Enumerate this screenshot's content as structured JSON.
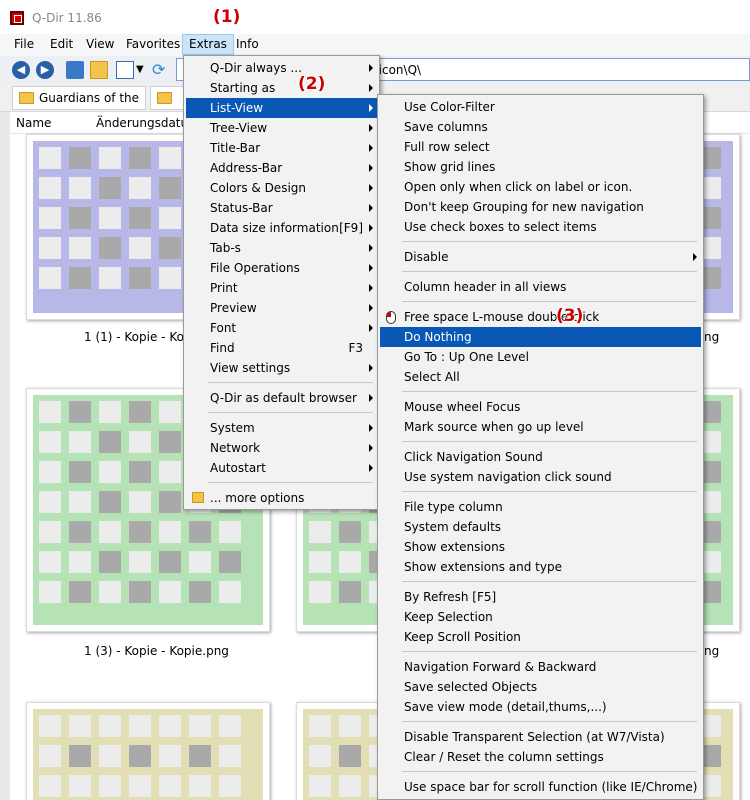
{
  "window": {
    "title": "Q-Dir 11.86"
  },
  "menubar": {
    "items": [
      "File",
      "Edit",
      "View",
      "Favorites",
      "Extras",
      "Info"
    ],
    "active": "Extras"
  },
  "address": {
    "value": "g\\icon\\Q\\"
  },
  "tabs": [
    {
      "label": "Guardians of the ..."
    }
  ],
  "columns": {
    "name": "Name",
    "date": "Änderungsdatum"
  },
  "thumbnails": [
    {
      "label": "1 (1) - Kopie - Kopi",
      "color": "#b7b7e8"
    },
    {
      "label": "1 (3) - Kopie - Kopie.png",
      "color": "#b5e3b5"
    }
  ],
  "thumb_right_labels": [
    "ng",
    "ng"
  ],
  "thumb_colors": {
    "purple": "#b7b7e8",
    "green": "#b5e3b5",
    "beige": "#e3dfb5",
    "cell": "#ececec",
    "dark": "#a9a9a9"
  },
  "extras_menu": {
    "items": [
      {
        "label": "Q-Dir always ...",
        "arrow": true
      },
      {
        "label": "Starting as",
        "arrow": true
      },
      {
        "label": "List-View",
        "arrow": true,
        "highlight": true
      },
      {
        "label": "Tree-View",
        "arrow": true
      },
      {
        "label": "Title-Bar",
        "arrow": true
      },
      {
        "label": "Address-Bar",
        "arrow": true
      },
      {
        "label": "Colors & Design",
        "arrow": true
      },
      {
        "label": "Status-Bar",
        "arrow": true
      },
      {
        "label": "Data size information",
        "shortcut": "[F9]",
        "arrow": true
      },
      {
        "label": "Tab-s",
        "arrow": true
      },
      {
        "label": "File Operations",
        "arrow": true
      },
      {
        "label": "Print",
        "arrow": true
      },
      {
        "label": "Preview",
        "arrow": true
      },
      {
        "label": "Font",
        "arrow": true
      },
      {
        "label": "Find",
        "shortcut": "F3"
      },
      {
        "label": "View settings",
        "arrow": true
      },
      {
        "label": "Q-Dir as default browser",
        "arrow": true
      },
      {
        "label": "System",
        "arrow": true
      },
      {
        "label": "Network",
        "arrow": true
      },
      {
        "label": "Autostart",
        "arrow": true
      },
      {
        "label": "... more options",
        "icon": "folder-icon"
      }
    ]
  },
  "listview_menu": {
    "items": [
      {
        "label": "Use Color-Filter"
      },
      {
        "label": "Save columns"
      },
      {
        "label": "Full row select"
      },
      {
        "label": "Show grid lines"
      },
      {
        "label": "Open only when click on label or icon."
      },
      {
        "label": "Don't keep Grouping for new navigation"
      },
      {
        "label": "Use check boxes to select items"
      },
      {
        "label": "Disable",
        "arrow": true
      },
      {
        "label": "Column header in all views"
      },
      {
        "label": "Free space L-mouse double-click",
        "icon": "mouse-icon"
      },
      {
        "label": "Do Nothing",
        "highlight": true
      },
      {
        "label": "Go To : Up One Level"
      },
      {
        "label": "Select All"
      },
      {
        "label": "Mouse wheel Focus"
      },
      {
        "label": "Mark source when go up level"
      },
      {
        "label": "Click Navigation Sound"
      },
      {
        "label": "Use system navigation click sound"
      },
      {
        "label": "File type column"
      },
      {
        "label": "System defaults"
      },
      {
        "label": "Show extensions"
      },
      {
        "label": "Show extensions and type"
      },
      {
        "label": "By Refresh [F5]"
      },
      {
        "label": "Keep Selection"
      },
      {
        "label": "Keep Scroll Position"
      },
      {
        "label": "Navigation Forward & Backward"
      },
      {
        "label": "Save selected Objects"
      },
      {
        "label": "Save view mode (detail,thums,...)"
      },
      {
        "label": "Disable Transparent Selection (at W7/Vista)"
      },
      {
        "label": "Clear / Reset the column settings"
      },
      {
        "label": "Use space bar for scroll function (like IE/Chrome)"
      }
    ]
  },
  "annotations": [
    "(1)",
    "(2)",
    "(3)"
  ],
  "colors": {
    "highlight": "#0a58b5",
    "annotation": "#cc0000"
  }
}
